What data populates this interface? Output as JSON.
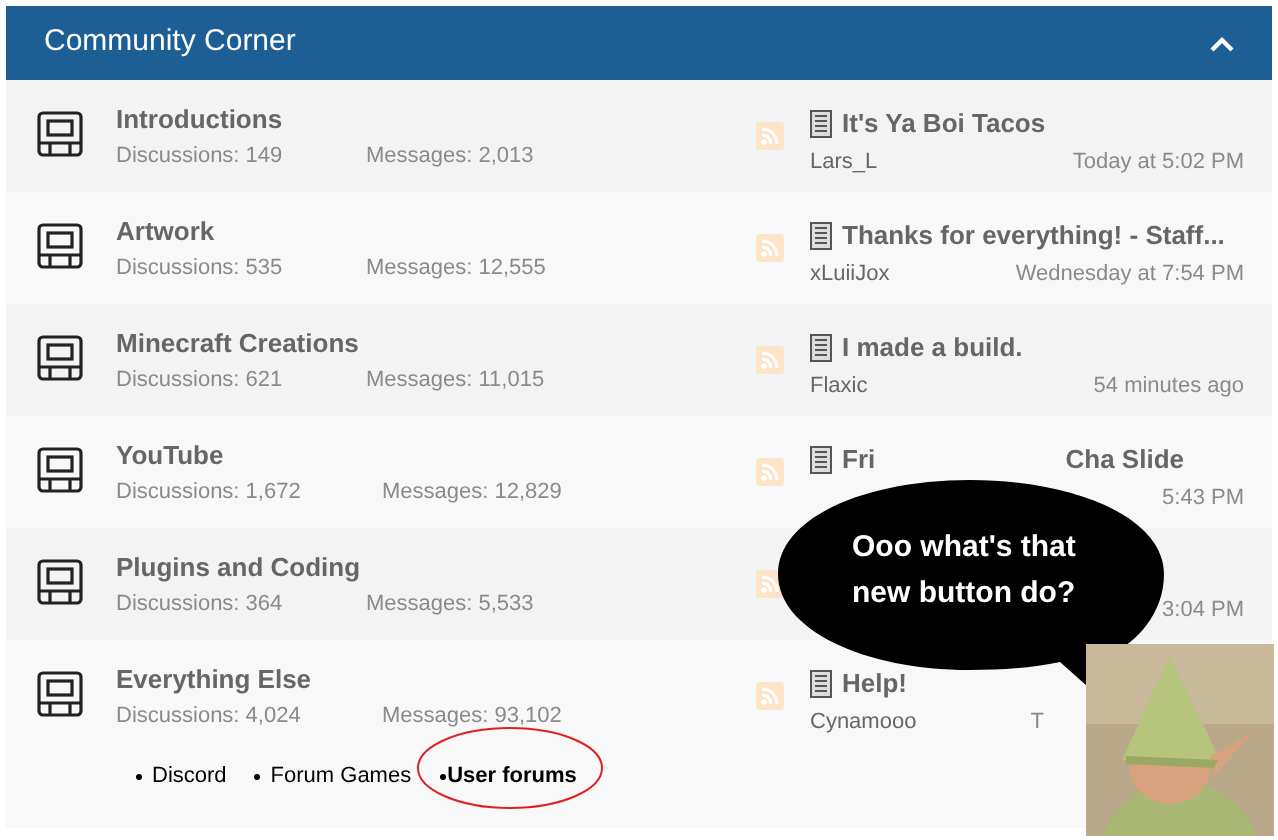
{
  "header": {
    "title": "Community Corner",
    "expanded": true
  },
  "forums": [
    {
      "title": "Introductions",
      "discussions": "Discussions: 149",
      "messages": "Messages: 2,013",
      "last_post": {
        "title": "It's Ya Boi Tacos",
        "user": "Lars_L",
        "time": "Today at 5:02 PM"
      }
    },
    {
      "title": "Artwork",
      "discussions": "Discussions: 535",
      "messages": "Messages: 12,555",
      "last_post": {
        "title": "Thanks for everything! - Staff...",
        "user": "xLuiiJox",
        "time": "Wednesday at 7:54 PM"
      }
    },
    {
      "title": "Minecraft Creations",
      "discussions": "Discussions: 621",
      "messages": "Messages: 11,015",
      "last_post": {
        "title": "I made a build.",
        "user": "Flaxic",
        "time": "54 minutes ago"
      }
    },
    {
      "title": "YouTube",
      "discussions": "Discussions: 1,672",
      "messages": "Messages: 12,829",
      "last_post": {
        "title": "Fri",
        "title_end": "Cha Slide",
        "time": "5:43 PM"
      }
    },
    {
      "title": "Plugins and Coding",
      "discussions": "Discussions: 364",
      "messages": "Messages: 5,533",
      "last_post": {
        "time": "3:04 PM"
      }
    },
    {
      "title": "Everything Else",
      "discussions": "Discussions: 4,024",
      "messages": "Messages: 93,102",
      "last_post": {
        "title": "Help!",
        "user": "Cynamooo",
        "time": "T"
      },
      "subforums": [
        {
          "label": "Discord",
          "highlighted": false
        },
        {
          "label": "Forum Games",
          "highlighted": false
        },
        {
          "label": "User forums",
          "highlighted": true
        }
      ]
    }
  ],
  "overlay": {
    "bubble_text": "Ooo what's that new button do?",
    "kind": "picture"
  }
}
